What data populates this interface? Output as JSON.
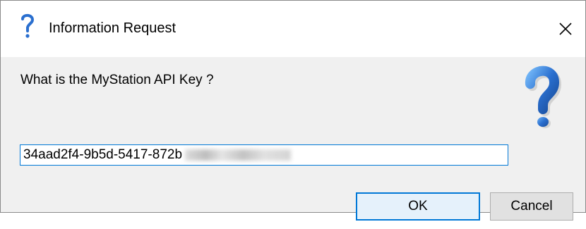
{
  "window": {
    "title": "Information Request",
    "title_icon": "question-icon",
    "close_icon": "close-icon",
    "close_glyph": "✕"
  },
  "dialog": {
    "prompt": "What is the MyStation API Key ?",
    "large_icon": "question-icon",
    "input_value": "34aad2f4-9b5d-5417-872b",
    "input_obscured": true,
    "ok_label": "OK",
    "cancel_label": "Cancel"
  },
  "colors": {
    "accent": "#0078d7",
    "question_blue": "#2a6fcf",
    "dialog_bg": "#f0f0f0",
    "titlebar_bg": "#ffffff"
  }
}
